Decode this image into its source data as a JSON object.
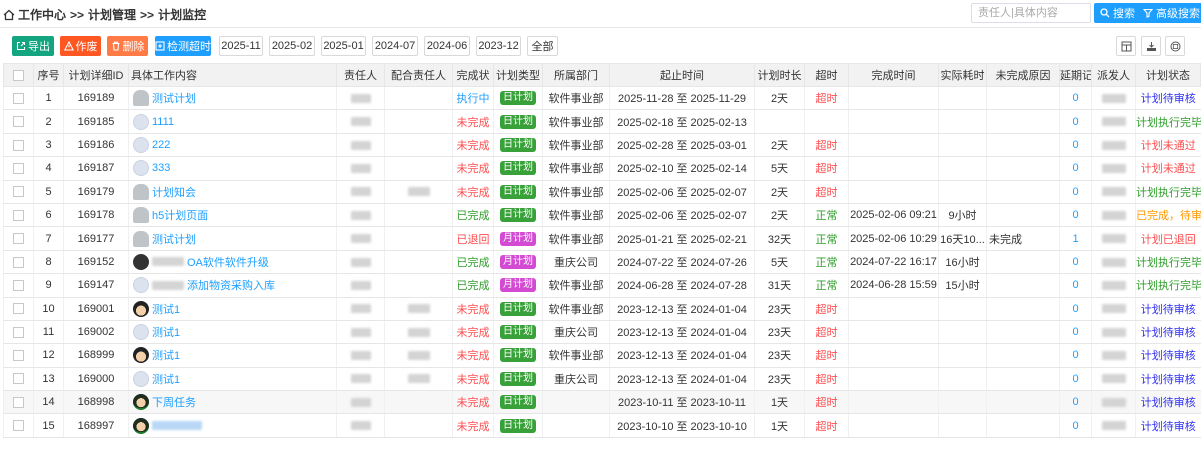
{
  "breadcrumb": {
    "work_center": "工作中心",
    "sep": ">>",
    "plan_manage": "计划管理",
    "plan_monitor": "计划监控"
  },
  "search": {
    "placeholder": "责任人|具体内容",
    "search_label": "搜索",
    "advanced_label": "高级搜索"
  },
  "toolbar": {
    "export_label": "导出",
    "void_label": "作废",
    "delete_label": "删除",
    "detect_label": "检测超时",
    "filters": [
      "2025-11",
      "2025-02",
      "2025-01",
      "2024-07",
      "2024-06",
      "2023-12",
      "全部"
    ]
  },
  "colors": {
    "primary": "#1e9fff",
    "export": "#13a580",
    "void": "#ff5722",
    "delete": "#ff7a45",
    "day_tag": "#39a13a",
    "month_tag": "#d34bd3"
  },
  "table": {
    "headers": [
      "序号",
      "计划详细ID",
      "具体工作内容",
      "责任人",
      "配合责任人",
      "完成状",
      "计划类型",
      "所属部门",
      "起止时间",
      "计划时长",
      "超时",
      "完成时间",
      "实际耗时",
      "未完成原因",
      "延期记",
      "派发人",
      "计划状态"
    ],
    "rows": [
      {
        "no": "1",
        "id": "169189",
        "avatar": "grey",
        "content": "测试计划",
        "person2": false,
        "status": "执行中",
        "status_cls": "st-run",
        "type": "日计划",
        "type_cls": "tag-day",
        "dept": "软件事业部",
        "range": "2025-11-28 至 2025-11-29",
        "duration": "2天",
        "timeout": "超时",
        "timeout_cls": "over",
        "done_time": "",
        "actual": "",
        "reason": "",
        "delay": "0",
        "plan_state": "计划待审核",
        "state_cls": "s-wait"
      },
      {
        "no": "2",
        "id": "169185",
        "avatar": "light",
        "content": "1111",
        "person2": false,
        "status": "未完成",
        "status_cls": "st-no",
        "type": "日计划",
        "type_cls": "tag-day",
        "dept": "软件事业部",
        "range": "2025-02-18 至 2025-02-13",
        "duration": "",
        "timeout": "",
        "timeout_cls": "",
        "done_time": "",
        "actual": "",
        "reason": "",
        "delay": "0",
        "plan_state": "计划执行完毕",
        "state_cls": "s-doneok"
      },
      {
        "no": "3",
        "id": "169186",
        "avatar": "light",
        "content": "222",
        "person2": false,
        "status": "未完成",
        "status_cls": "st-no",
        "type": "日计划",
        "type_cls": "tag-day",
        "dept": "软件事业部",
        "range": "2025-02-28 至 2025-03-01",
        "duration": "2天",
        "timeout": "超时",
        "timeout_cls": "over",
        "done_time": "",
        "actual": "",
        "reason": "",
        "delay": "0",
        "plan_state": "计划未通过",
        "state_cls": "s-fail"
      },
      {
        "no": "4",
        "id": "169187",
        "avatar": "light",
        "content": "333",
        "person2": false,
        "status": "未完成",
        "status_cls": "st-no",
        "type": "日计划",
        "type_cls": "tag-day",
        "dept": "软件事业部",
        "range": "2025-02-10 至 2025-02-14",
        "duration": "5天",
        "timeout": "超时",
        "timeout_cls": "over",
        "done_time": "",
        "actual": "",
        "reason": "",
        "delay": "0",
        "plan_state": "计划未通过",
        "state_cls": "s-fail"
      },
      {
        "no": "5",
        "id": "169179",
        "avatar": "grey",
        "content": "计划知会",
        "person2": true,
        "status": "未完成",
        "status_cls": "st-no",
        "type": "日计划",
        "type_cls": "tag-day",
        "dept": "软件事业部",
        "range": "2025-02-06 至 2025-02-07",
        "duration": "2天",
        "timeout": "超时",
        "timeout_cls": "over",
        "done_time": "",
        "actual": "",
        "reason": "",
        "delay": "0",
        "plan_state": "计划执行完毕",
        "state_cls": "s-doneok"
      },
      {
        "no": "6",
        "id": "169178",
        "avatar": "grey",
        "content": "h5计划页面",
        "person2": false,
        "status": "已完成",
        "status_cls": "st-done",
        "type": "日计划",
        "type_cls": "tag-day",
        "dept": "软件事业部",
        "range": "2025-02-06 至 2025-02-07",
        "duration": "2天",
        "timeout": "正常",
        "timeout_cls": "normal",
        "done_time": "2025-02-06 09:21",
        "actual": "9小时",
        "reason": "",
        "delay": "0",
        "plan_state": "已完成，待审",
        "state_cls": "s-pend"
      },
      {
        "no": "7",
        "id": "169177",
        "avatar": "grey",
        "content": "测试计划",
        "person2": false,
        "status": "已退回",
        "status_cls": "st-no",
        "type": "月计划",
        "type_cls": "tag-month",
        "dept": "软件事业部",
        "range": "2025-01-21 至 2025-02-21",
        "duration": "32天",
        "timeout": "正常",
        "timeout_cls": "normal",
        "done_time": "2025-02-06 10:29",
        "actual": "16天10...",
        "reason": "未完成",
        "delay": "1",
        "plan_state": "计划已退回",
        "state_cls": "s-back"
      },
      {
        "no": "8",
        "id": "169152",
        "avatar": "dark",
        "content": "OA软件软件升级",
        "person2": false,
        "status": "已完成",
        "status_cls": "st-done",
        "type": "月计划",
        "type_cls": "tag-month",
        "dept": "重庆公司",
        "range": "2024-07-22 至 2024-07-26",
        "duration": "5天",
        "timeout": "正常",
        "timeout_cls": "normal",
        "done_time": "2024-07-22 16:17",
        "actual": "16小时",
        "reason": "",
        "delay": "0",
        "plan_state": "计划执行完毕",
        "state_cls": "s-doneok"
      },
      {
        "no": "9",
        "id": "169147",
        "avatar": "light",
        "content": "添加物资采购入库",
        "person2": false,
        "status": "已完成",
        "status_cls": "st-done",
        "type": "月计划",
        "type_cls": "tag-month",
        "dept": "软件事业部",
        "range": "2024-06-28 至 2024-07-28",
        "duration": "31天",
        "timeout": "正常",
        "timeout_cls": "normal",
        "done_time": "2024-06-28 15:59",
        "actual": "15小时",
        "reason": "",
        "delay": "0",
        "plan_state": "计划执行完毕",
        "state_cls": "s-doneok"
      },
      {
        "no": "10",
        "id": "169001",
        "avatar": "face",
        "content": "测试1",
        "person2": true,
        "status": "未完成",
        "status_cls": "st-no",
        "type": "日计划",
        "type_cls": "tag-day",
        "dept": "软件事业部",
        "range": "2023-12-13 至 2024-01-04",
        "duration": "23天",
        "timeout": "超时",
        "timeout_cls": "over",
        "done_time": "",
        "actual": "",
        "reason": "",
        "delay": "0",
        "plan_state": "计划待审核",
        "state_cls": "s-wait"
      },
      {
        "no": "11",
        "id": "169002",
        "avatar": "light",
        "content": "测试1",
        "person2": true,
        "status": "未完成",
        "status_cls": "st-no",
        "type": "日计划",
        "type_cls": "tag-day",
        "dept": "重庆公司",
        "range": "2023-12-13 至 2024-01-04",
        "duration": "23天",
        "timeout": "超时",
        "timeout_cls": "over",
        "done_time": "",
        "actual": "",
        "reason": "",
        "delay": "0",
        "plan_state": "计划待审核",
        "state_cls": "s-wait"
      },
      {
        "no": "12",
        "id": "168999",
        "avatar": "face",
        "content": "测试1",
        "person2": true,
        "status": "未完成",
        "status_cls": "st-no",
        "type": "日计划",
        "type_cls": "tag-day",
        "dept": "软件事业部",
        "range": "2023-12-13 至 2024-01-04",
        "duration": "23天",
        "timeout": "超时",
        "timeout_cls": "over",
        "done_time": "",
        "actual": "",
        "reason": "",
        "delay": "0",
        "plan_state": "计划待审核",
        "state_cls": "s-wait"
      },
      {
        "no": "13",
        "id": "169000",
        "avatar": "light",
        "content": "测试1",
        "person2": true,
        "status": "未完成",
        "status_cls": "st-no",
        "type": "日计划",
        "type_cls": "tag-day",
        "dept": "重庆公司",
        "range": "2023-12-13 至 2024-01-04",
        "duration": "23天",
        "timeout": "超时",
        "timeout_cls": "over",
        "done_time": "",
        "actual": "",
        "reason": "",
        "delay": "0",
        "plan_state": "计划待审核",
        "state_cls": "s-wait"
      },
      {
        "no": "14",
        "id": "168998",
        "avatar": "green",
        "content": "下周任务",
        "person2": false,
        "status": "未完成",
        "status_cls": "st-no",
        "type": "日计划",
        "type_cls": "tag-day",
        "dept": "",
        "range": "2023-10-11 至 2023-10-11",
        "duration": "1天",
        "timeout": "超时",
        "timeout_cls": "over",
        "done_time": "",
        "actual": "",
        "reason": "",
        "delay": "0",
        "plan_state": "计划待审核",
        "state_cls": "s-wait"
      },
      {
        "no": "15",
        "id": "168997",
        "avatar": "green",
        "content": "",
        "person2": false,
        "status": "未完成",
        "status_cls": "st-no",
        "type": "日计划",
        "type_cls": "tag-day",
        "dept": "",
        "range": "2023-10-10 至 2023-10-10",
        "duration": "1天",
        "timeout": "超时",
        "timeout_cls": "over",
        "done_time": "",
        "actual": "",
        "reason": "",
        "delay": "0",
        "plan_state": "计划待审核",
        "state_cls": "s-wait"
      }
    ]
  }
}
